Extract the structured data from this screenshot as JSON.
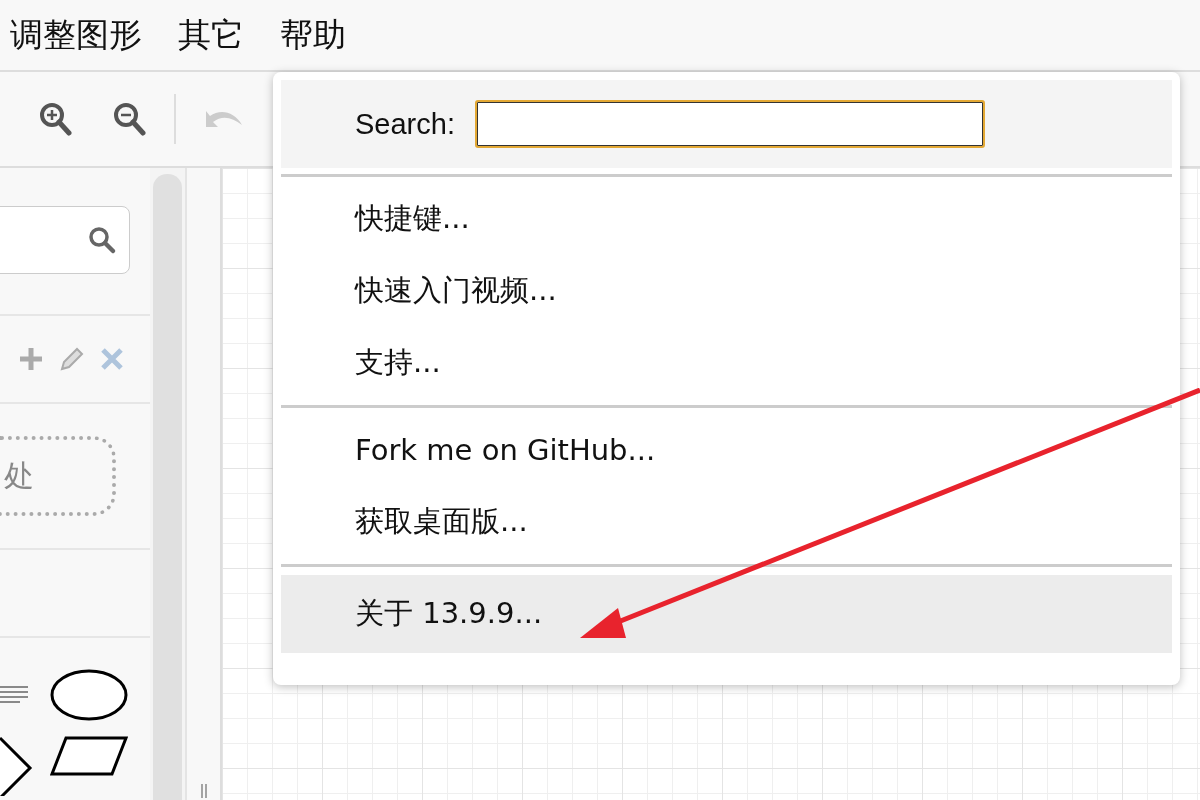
{
  "menubar": [
    {
      "label": "调整图形"
    },
    {
      "label": "其它"
    },
    {
      "label": "帮助"
    }
  ],
  "sidebar": {
    "drop_area": {
      "text": "处"
    }
  },
  "help_menu": {
    "search": {
      "label": "Search:"
    },
    "groups": [
      [
        {
          "label": "快捷键...",
          "selected": false
        },
        {
          "label": "快速入门视频...",
          "selected": false
        },
        {
          "label": "支持...",
          "selected": false
        }
      ],
      [
        {
          "label": "Fork me on GitHub...",
          "selected": false
        },
        {
          "label": "获取桌面版...",
          "selected": false
        }
      ],
      [
        {
          "label": "关于 13.9.9...",
          "selected": true
        }
      ]
    ]
  }
}
